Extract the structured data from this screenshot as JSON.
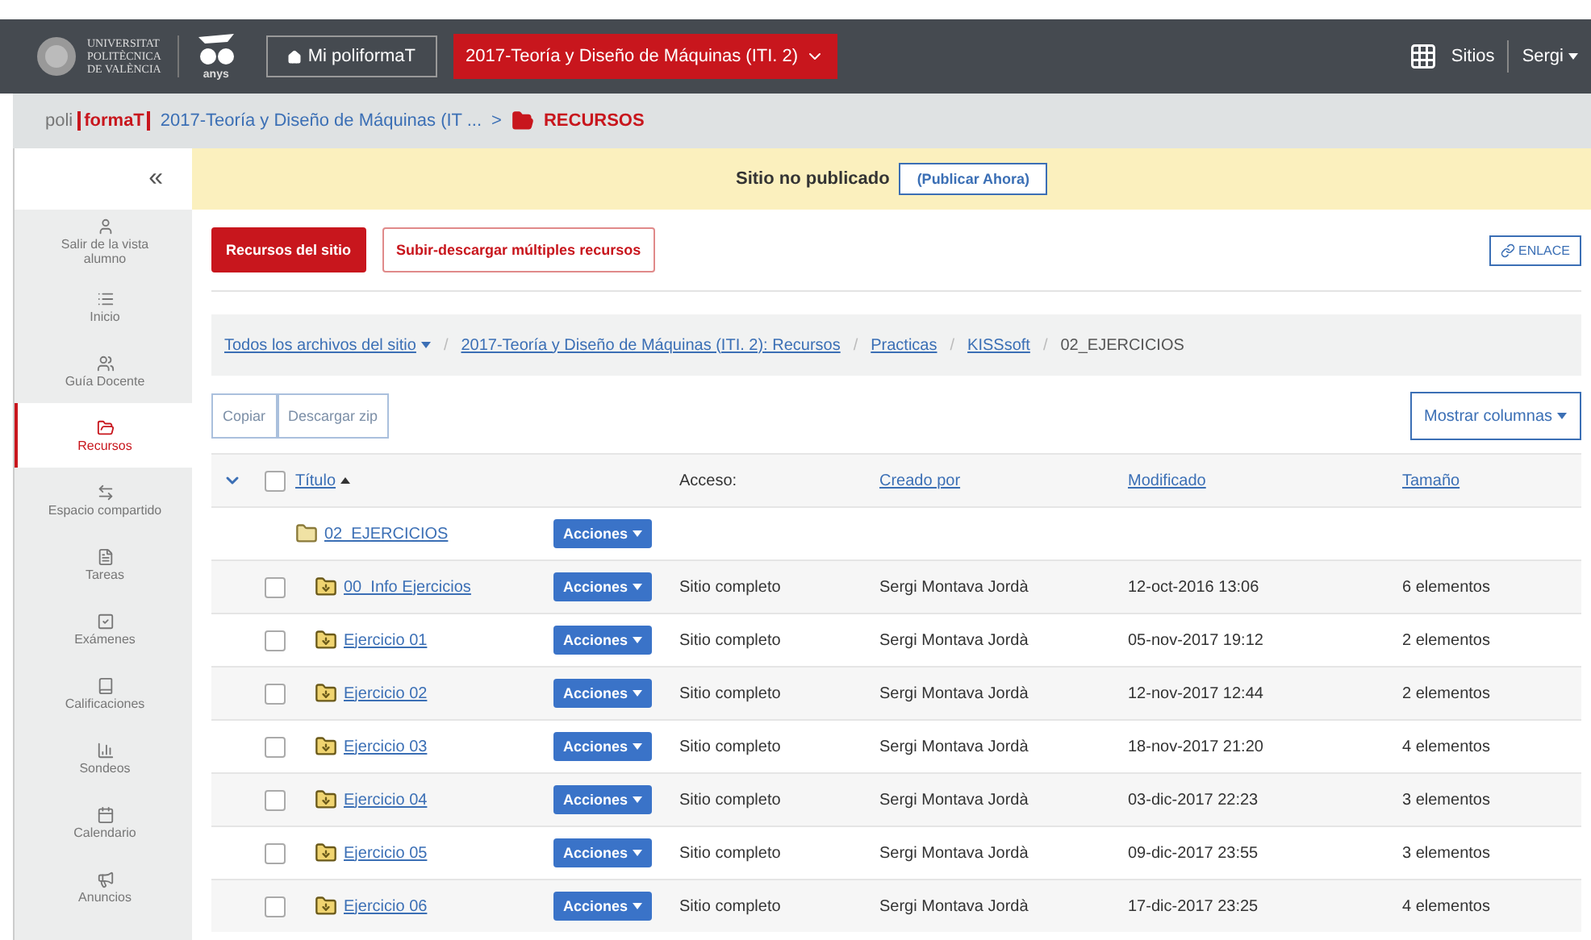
{
  "header": {
    "university": [
      "UNIVERSITAT",
      "POLITÈCNICA",
      "DE VALÈNCIA"
    ],
    "anniversary": "anys",
    "home_button": "Mi poliformaT",
    "site_button": "2017-Teoría y Diseño de Máquinas (ITI. 2)",
    "sites": "Sitios",
    "user": "Sergi"
  },
  "crumbs": {
    "logo_left": "poli",
    "logo_right": "formaT",
    "course": "2017-Teoría y Diseño de Máquinas (IT ...",
    "separator": ">",
    "section": "RECURSOS"
  },
  "sidebar": {
    "collapse": "«",
    "items": [
      {
        "label": "Salir de la vista alumno",
        "selected": false
      },
      {
        "label": "Inicio",
        "selected": false
      },
      {
        "label": "Guía Docente",
        "selected": false
      },
      {
        "label": "Recursos",
        "selected": true
      },
      {
        "label": "Espacio compartido",
        "selected": false
      },
      {
        "label": "Tareas",
        "selected": false
      },
      {
        "label": "Exámenes",
        "selected": false
      },
      {
        "label": "Calificaciones",
        "selected": false
      },
      {
        "label": "Sondeos",
        "selected": false
      },
      {
        "label": "Calendario",
        "selected": false
      },
      {
        "label": "Anuncios",
        "selected": false
      }
    ]
  },
  "banner": {
    "text": "Sitio no publicado",
    "button": "(Publicar Ahora)"
  },
  "tabs": [
    {
      "label": "Recursos del sitio",
      "selected": true
    },
    {
      "label": "Subir-descargar múltiples recursos",
      "selected": false
    }
  ],
  "link_button": "ENLACE",
  "path": [
    {
      "label": "Todos los archivos del sitio",
      "kind": "dropdown"
    },
    {
      "label": "2017-Teoría y Diseño de Máquinas (ITI. 2): Recursos",
      "kind": "link"
    },
    {
      "label": "Practicas",
      "kind": "link"
    },
    {
      "label": "KISSsoft",
      "kind": "link"
    },
    {
      "label": "02_EJERCICIOS",
      "kind": "current"
    }
  ],
  "path_separator": "/",
  "actions": [
    "Copiar",
    "Descargar zip"
  ],
  "columns_button": "Mostrar columnas",
  "table": {
    "select_all_checked": false,
    "columns": [
      "Título",
      "Acceso:",
      "Creado por",
      "Modificado",
      "Tamaño"
    ],
    "parent": {
      "title": "02_EJERCICIOS",
      "actions": "Acciones"
    },
    "rows": [
      {
        "title": "00_Info Ejercicios",
        "actions": "Acciones",
        "access": "Sitio completo",
        "creator": "Sergi Montava Jordà",
        "modified": "12-oct-2016 13:06",
        "size": "6 elementos",
        "checked": false
      },
      {
        "title": "Ejercicio 01",
        "actions": "Acciones",
        "access": "Sitio completo",
        "creator": "Sergi Montava Jordà",
        "modified": "05-nov-2017 19:12",
        "size": "2 elementos",
        "checked": false
      },
      {
        "title": "Ejercicio 02",
        "actions": "Acciones",
        "access": "Sitio completo",
        "creator": "Sergi Montava Jordà",
        "modified": "12-nov-2017 12:44",
        "size": "2 elementos",
        "checked": false
      },
      {
        "title": "Ejercicio 03",
        "actions": "Acciones",
        "access": "Sitio completo",
        "creator": "Sergi Montava Jordà",
        "modified": "18-nov-2017 21:20",
        "size": "4 elementos",
        "checked": false
      },
      {
        "title": "Ejercicio 04",
        "actions": "Acciones",
        "access": "Sitio completo",
        "creator": "Sergi Montava Jordà",
        "modified": "03-dic-2017 22:23",
        "size": "3 elementos",
        "checked": false
      },
      {
        "title": "Ejercicio 05",
        "actions": "Acciones",
        "access": "Sitio completo",
        "creator": "Sergi Montava Jordà",
        "modified": "09-dic-2017 23:55",
        "size": "3 elementos",
        "checked": false
      },
      {
        "title": "Ejercicio 06",
        "actions": "Acciones",
        "access": "Sitio completo",
        "creator": "Sergi Montava Jordà",
        "modified": "17-dic-2017 23:25",
        "size": "4 elementos",
        "checked": false
      }
    ]
  }
}
